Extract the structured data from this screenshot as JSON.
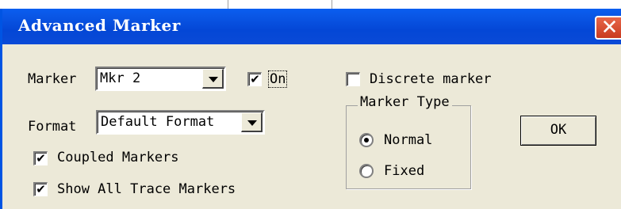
{
  "window": {
    "title": "Advanced Marker",
    "close_glyph": "✕"
  },
  "marker": {
    "label": "Marker",
    "value": "Mkr 2",
    "on_label": "On",
    "on_checked": true
  },
  "format": {
    "label": "Format",
    "value": "Default Format"
  },
  "discrete": {
    "label": "Discrete marker",
    "checked": false
  },
  "coupled": {
    "label": "Coupled Markers",
    "checked": true
  },
  "show_all": {
    "label": "Show All Trace Markers",
    "checked": true
  },
  "marker_type": {
    "title": "Marker Type",
    "options": [
      {
        "label": "Normal",
        "selected": true
      },
      {
        "label": "Fixed",
        "selected": false
      }
    ]
  },
  "ok_label": "OK",
  "check_glyph": "✔",
  "colors": {
    "titlebar": "#0a5ef0",
    "close": "#d4502f",
    "face": "#ece9d8"
  }
}
